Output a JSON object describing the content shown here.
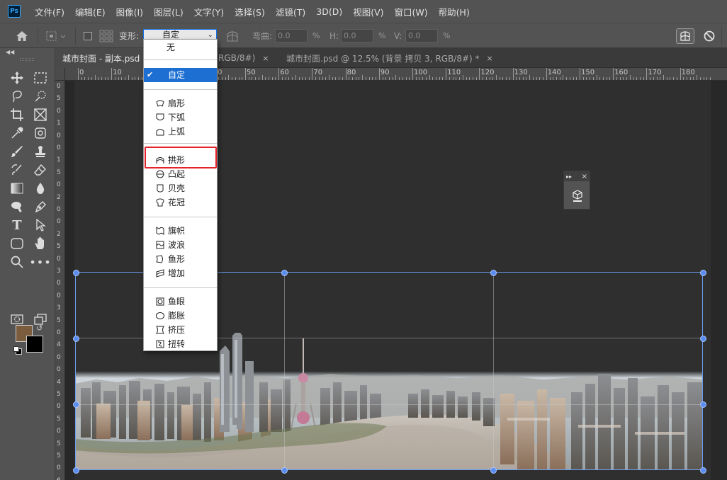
{
  "app": {
    "logo": "Ps"
  },
  "menu": [
    "文件(F)",
    "编辑(E)",
    "图像(I)",
    "图层(L)",
    "文字(Y)",
    "选择(S)",
    "滤镜(T)",
    "3D(D)",
    "视图(V)",
    "窗口(W)",
    "帮助(H)"
  ],
  "options": {
    "warp_label": "变形:",
    "warp_value": "自定",
    "bend_label": "弯曲:",
    "bend_value": "0.0",
    "h_label": "H:",
    "h_value": "0.0",
    "v_label": "V:",
    "v_value": "0.0",
    "percent": "%"
  },
  "tabs": [
    {
      "label": "城市封面 - 副本.psd",
      "active": true
    },
    {
      "label": "RGB/8#)",
      "active": false,
      "close": "×"
    },
    {
      "label": "城市封面.psd @ 12.5% (背景 拷贝 3, RGB/8#) *",
      "active": false,
      "close": "×"
    }
  ],
  "ruler_top": [
    "0",
    "10",
    "20",
    "30",
    "40",
    "50",
    "60",
    "70",
    "80",
    "90",
    "100",
    "110",
    "120",
    "130",
    "140",
    "150",
    "160",
    "170",
    "180"
  ],
  "ruler_left": [
    "0",
    "5",
    "0",
    "1",
    "0",
    "0",
    "1",
    "5",
    "0",
    "2",
    "0",
    "0",
    "2",
    "5",
    "0",
    "3",
    "0",
    "0",
    "3",
    "5",
    "0",
    "4",
    "0",
    "0",
    "4",
    "5",
    "0",
    "5",
    "0",
    "5",
    "5",
    "0",
    "6"
  ],
  "warp_menu": {
    "none": "无",
    "custom": "自定",
    "group1": [
      "扇形",
      "下弧",
      "上弧"
    ],
    "group2": [
      "拱形",
      "凸起",
      "贝壳",
      "花冠"
    ],
    "group3": [
      "旗帜",
      "波浪",
      "鱼形",
      "增加"
    ],
    "group4": [
      "鱼眼",
      "膨胀",
      "挤压",
      "扭转"
    ],
    "highlighted": "拱形"
  },
  "colors": {
    "accent": "#1e6fd2",
    "highlight": "#e4232a",
    "foreground": "#7b5c3c",
    "background": "#000000",
    "transform": "#5b8def"
  }
}
